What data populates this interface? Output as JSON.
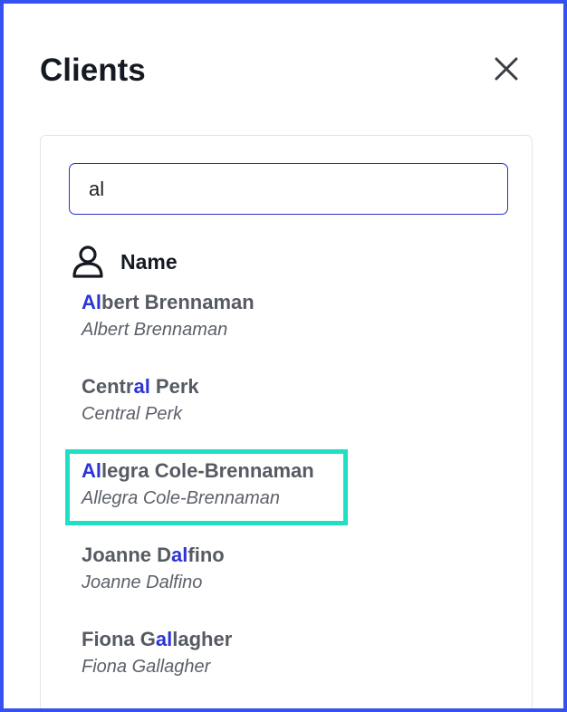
{
  "dialog": {
    "title": "Clients",
    "close_icon": "close-icon"
  },
  "search": {
    "value": "al",
    "placeholder": ""
  },
  "column_header": {
    "icon": "user-icon",
    "label": "Name"
  },
  "results": [
    {
      "primary": {
        "before": "",
        "match": "Al",
        "after": "bert Brennaman"
      },
      "secondary": "Albert Brennaman",
      "selected": false
    },
    {
      "primary": {
        "before": "Centr",
        "match": "al",
        "after": " Perk"
      },
      "secondary": "Central Perk",
      "selected": false
    },
    {
      "primary": {
        "before": "",
        "match": "Al",
        "after": "legra Cole-Brennaman"
      },
      "secondary": "Allegra Cole-Brennaman",
      "selected": true
    },
    {
      "primary": {
        "before": "Joanne D",
        "match": "al",
        "after": "fino"
      },
      "secondary": "Joanne Dalfino",
      "selected": false
    },
    {
      "primary": {
        "before": "Fiona G",
        "match": "al",
        "after": "lagher"
      },
      "secondary": "Fiona Gallagher",
      "selected": false
    }
  ],
  "colors": {
    "accent_border": "#3452f0",
    "match_highlight": "#2b35d6",
    "selection_outline": "#1fe0c5"
  }
}
